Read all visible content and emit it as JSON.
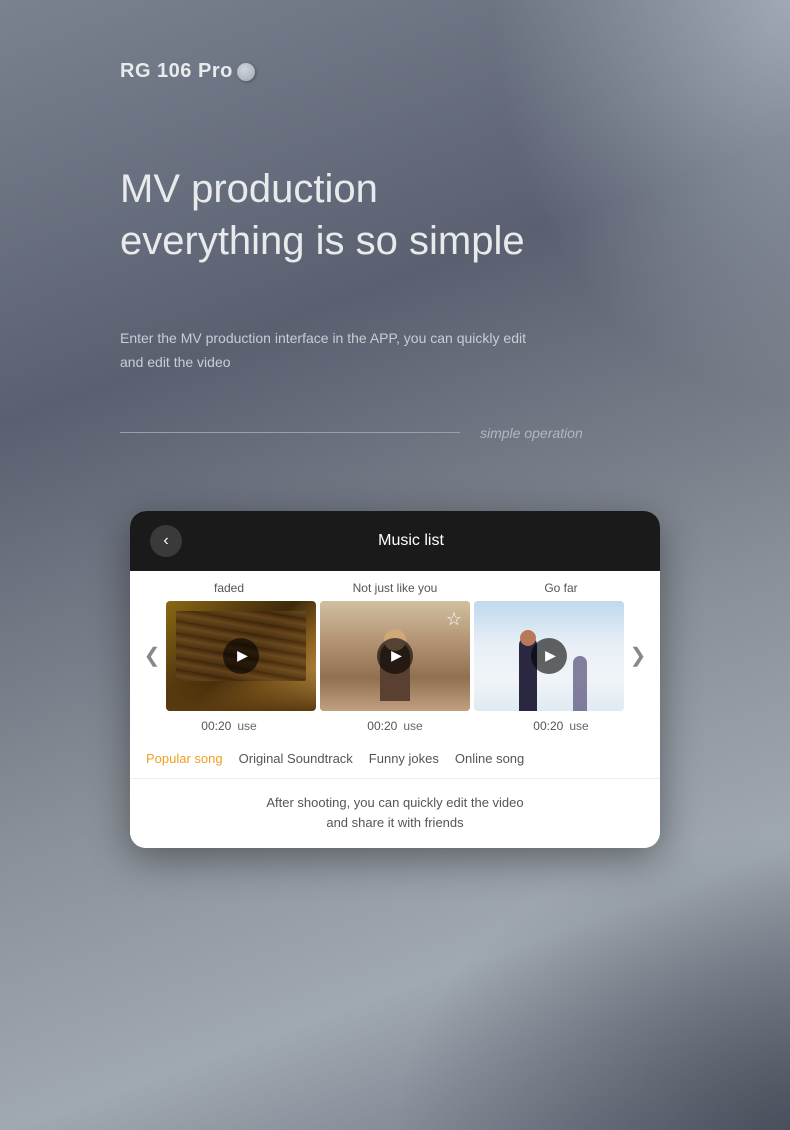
{
  "brand": {
    "name": "RG 106 Pro"
  },
  "headline": {
    "line1": "MV production",
    "line2": "everything is so simple"
  },
  "description": {
    "text": "Enter the MV production interface in the APP, you can quickly edit and edit the video"
  },
  "divider": {
    "label": "simple operation"
  },
  "music_card": {
    "title": "Music list",
    "back_label": "‹",
    "tracks": [
      {
        "id": 1,
        "name": "faded",
        "time": "00:20",
        "use_label": "use",
        "thumb_class": "track-thumb-1"
      },
      {
        "id": 2,
        "name": "Not just like you",
        "time": "00:20",
        "use_label": "use",
        "thumb_class": "track-thumb-2",
        "has_favorite": true
      },
      {
        "id": 3,
        "name": "Go far",
        "time": "00:20",
        "use_label": "use",
        "thumb_class": "track-thumb-3"
      }
    ],
    "categories": [
      {
        "id": "popular",
        "label": "Popular song",
        "active": true
      },
      {
        "id": "ost",
        "label": "Original Soundtrack",
        "active": false
      },
      {
        "id": "funny",
        "label": "Funny jokes",
        "active": false
      },
      {
        "id": "online",
        "label": "Online song",
        "active": false
      }
    ],
    "footer_line1": "After shooting, you can quickly edit the video",
    "footer_line2": "and share it with friends"
  }
}
